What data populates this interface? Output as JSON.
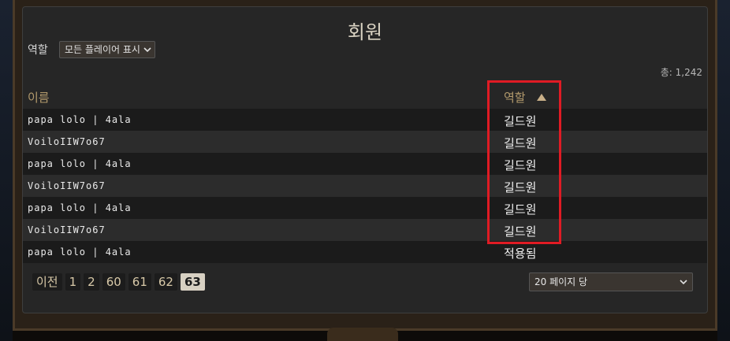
{
  "title": "회원",
  "filter": {
    "label": "역할",
    "selected": "모든 플레이어 표시"
  },
  "total": "총: 1,242",
  "columns": {
    "name": "이름",
    "role": "역할"
  },
  "rows": [
    {
      "name": "papa lolo | 4ala",
      "role": "길드원"
    },
    {
      "name": "VoiloIIW7o67",
      "role": "길드원"
    },
    {
      "name": "papa lolo | 4ala",
      "role": "길드원"
    },
    {
      "name": "VoiloIIW7o67",
      "role": "길드원"
    },
    {
      "name": "papa lolo | 4ala",
      "role": "길드원"
    },
    {
      "name": "VoiloIIW7o67",
      "role": "길드원"
    },
    {
      "name": "papa lolo | 4ala",
      "role": "적용됨"
    }
  ],
  "pagination": {
    "prev": "이전",
    "pages": [
      "1",
      "2",
      "60",
      "61",
      "62",
      "63"
    ],
    "current": "63"
  },
  "per_page": "20 페이지 당",
  "colors": {
    "highlight": "#e01b24",
    "header_text": "#b39a6c"
  }
}
